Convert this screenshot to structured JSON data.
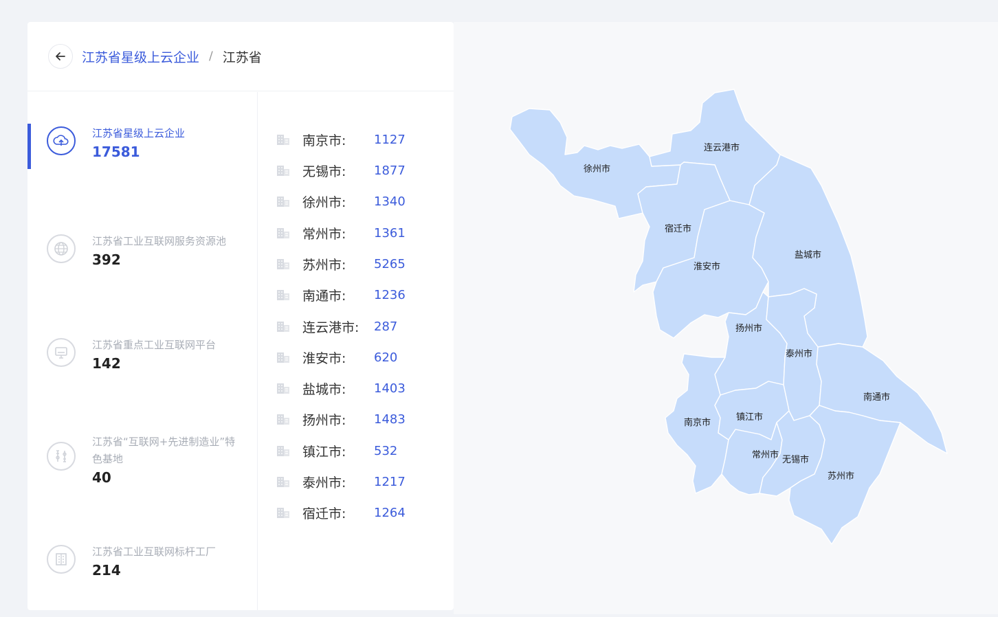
{
  "breadcrumb": {
    "parent": "江苏省星级上云企业",
    "separator": "/",
    "current": "江苏省"
  },
  "categories": [
    {
      "label": "江苏省星级上云企业",
      "value": "17581",
      "icon": "cloud-icon",
      "active": true
    },
    {
      "label": "江苏省工业互联网服务资源池",
      "value": "392",
      "icon": "globe-icon",
      "active": false
    },
    {
      "label": "江苏省重点工业互联网平台",
      "value": "142",
      "icon": "monitor-icon",
      "active": false
    },
    {
      "label": "江苏省“互联网+先进制造业”特色基地",
      "value": "40",
      "icon": "tools-icon",
      "active": false
    },
    {
      "label": "江苏省工业互联网标杆工厂",
      "value": "214",
      "icon": "building-icon",
      "active": false
    }
  ],
  "cities": [
    {
      "name": "南京市:",
      "value": "1127"
    },
    {
      "name": "无锡市:",
      "value": "1877"
    },
    {
      "name": "徐州市:",
      "value": "1340"
    },
    {
      "name": "常州市:",
      "value": "1361"
    },
    {
      "name": "苏州市:",
      "value": "5265"
    },
    {
      "name": "南通市:",
      "value": "1236"
    },
    {
      "name": "连云港市:",
      "value": "287"
    },
    {
      "name": "淮安市:",
      "value": "620"
    },
    {
      "name": "盐城市:",
      "value": "1403"
    },
    {
      "name": "扬州市:",
      "value": "1483"
    },
    {
      "name": "镇江市:",
      "value": "532"
    },
    {
      "name": "泰州市:",
      "value": "1217"
    },
    {
      "name": "宿迁市:",
      "value": "1264"
    }
  ],
  "map": {
    "labels": {
      "xuzhou": "徐州市",
      "lianyungang": "连云港市",
      "suqian": "宿迁市",
      "huaian": "淮安市",
      "yancheng": "盐城市",
      "yangzhou": "扬州市",
      "taizhou": "泰州市",
      "nantong": "南通市",
      "nanjing": "南京市",
      "zhenjiang": "镇江市",
      "changzhou": "常州市",
      "wuxi": "无锡市",
      "suzhou": "苏州市"
    },
    "fill_color": "#c6dcfb",
    "border_color": "#ffffff"
  },
  "colors": {
    "accent": "#3b5bdb",
    "muted": "#a8adb6"
  }
}
